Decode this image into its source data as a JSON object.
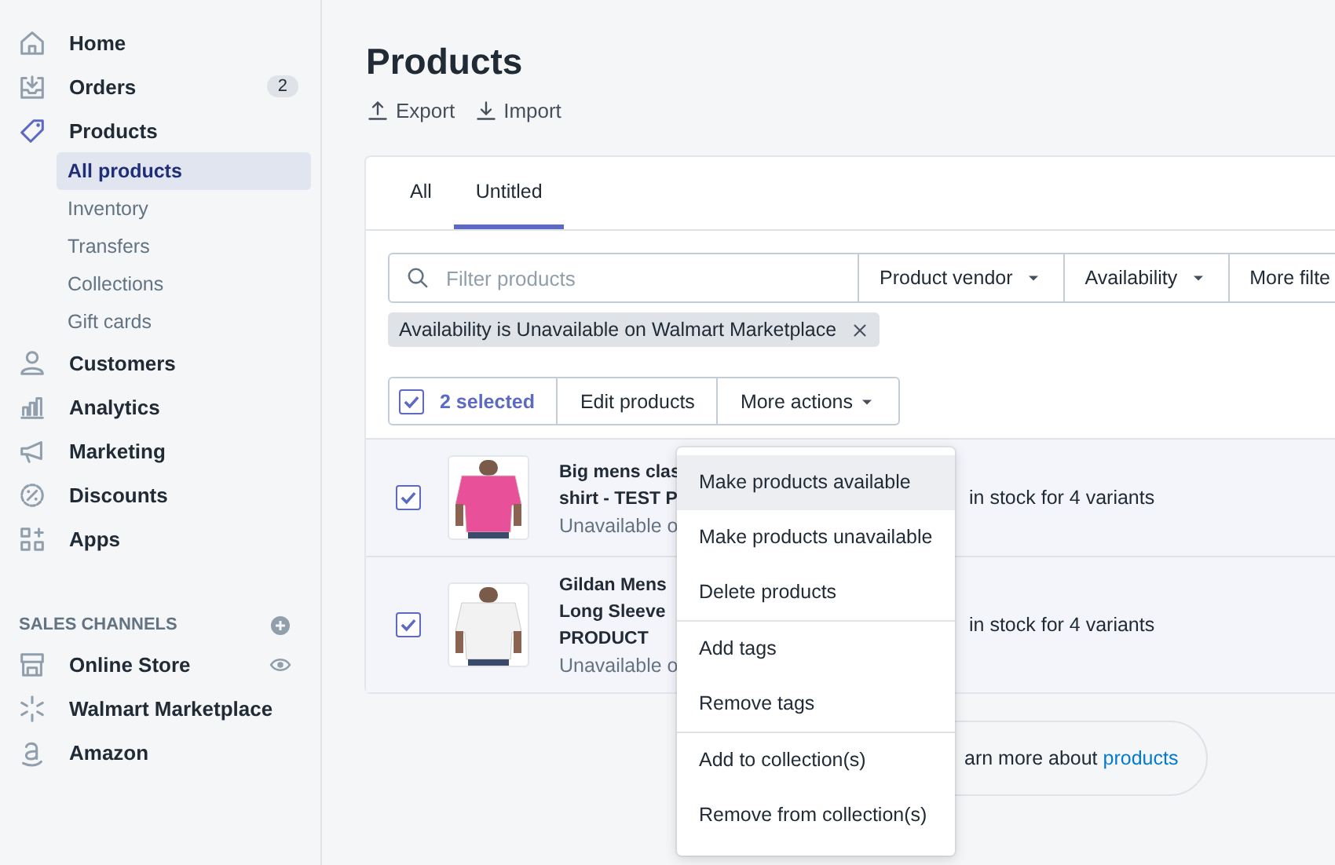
{
  "sidebar": {
    "items": [
      {
        "label": "Home",
        "selected": false
      },
      {
        "label": "Orders",
        "badge": "2",
        "selected": false
      },
      {
        "label": "Products",
        "selected": true,
        "children": [
          {
            "label": "All products",
            "selected": true
          },
          {
            "label": "Inventory",
            "selected": false
          },
          {
            "label": "Transfers",
            "selected": false
          },
          {
            "label": "Collections",
            "selected": false
          },
          {
            "label": "Gift cards",
            "selected": false
          }
        ]
      },
      {
        "label": "Customers",
        "selected": false
      },
      {
        "label": "Analytics",
        "selected": false
      },
      {
        "label": "Marketing",
        "selected": false
      },
      {
        "label": "Discounts",
        "selected": false
      },
      {
        "label": "Apps",
        "selected": false
      }
    ],
    "section_title": "SALES CHANNELS",
    "channels": [
      {
        "label": "Online Store"
      },
      {
        "label": "Walmart Marketplace"
      },
      {
        "label": "Amazon"
      }
    ]
  },
  "page": {
    "title": "Products",
    "actions": [
      {
        "label": "Export"
      },
      {
        "label": "Import"
      }
    ]
  },
  "tabs": [
    {
      "label": "All",
      "selected": false
    },
    {
      "label": "Untitled",
      "selected": true
    }
  ],
  "search": {
    "placeholder": "Filter products"
  },
  "filters": [
    {
      "label": "Product vendor",
      "kind": "dropdown"
    },
    {
      "label": "Availability",
      "kind": "dropdown"
    },
    {
      "label": "More filte",
      "kind": "button"
    }
  ],
  "applied_filter": "Availability is Unavailable on Walmart Marketplace",
  "bulk": {
    "checked": true,
    "count": "2 selected",
    "buttons": [
      {
        "label": "Edit products",
        "kind": "button"
      },
      {
        "label": "More actions",
        "kind": "dropdown"
      }
    ]
  },
  "rows": [
    {
      "checked": true,
      "title_lines": [
        "Big mens clas",
        "shirt - TEST P"
      ],
      "status": "Unavailable o",
      "inventory": "in stock for 4 variants"
    },
    {
      "checked": true,
      "title_lines": [
        "Gildan Mens",
        "Long Sleeve",
        "PRODUCT"
      ],
      "status": "Unavailable o",
      "inventory": "in stock for 4 variants"
    }
  ],
  "learn_more": {
    "text": "arn more about",
    "link": "products"
  },
  "menu": {
    "groups": [
      [
        {
          "label": "Make products available",
          "highlighted": true
        },
        {
          "label": "Make products unavailable",
          "highlighted": false
        },
        {
          "label": "Delete products",
          "highlighted": false
        }
      ],
      [
        {
          "label": "Add tags",
          "highlighted": false
        },
        {
          "label": "Remove tags",
          "highlighted": false
        }
      ],
      [
        {
          "label": "Add to collection(s)",
          "highlighted": false
        },
        {
          "label": "Remove from collection(s)",
          "highlighted": false
        }
      ]
    ]
  }
}
